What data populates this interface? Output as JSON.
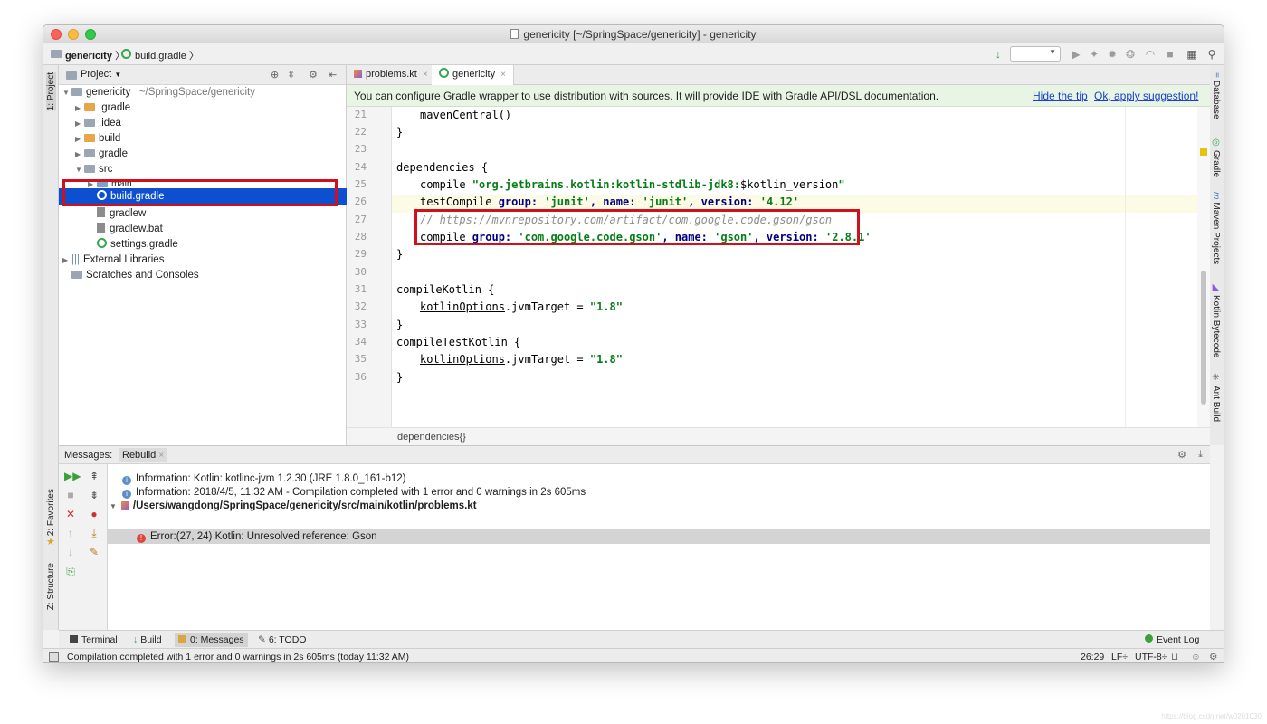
{
  "window": {
    "title": "genericity [~/SpringSpace/genericity] - genericity"
  },
  "breadcrumb": {
    "project": "genericity",
    "file": "build.gradle"
  },
  "toolwindows": {
    "left": {
      "project": "1: Project",
      "favorites": "2: Favorites",
      "structure": "Z: Structure"
    },
    "right": [
      "Database",
      "Gradle",
      "Maven Projects",
      "Kotlin Bytecode",
      "Ant Build"
    ]
  },
  "project_panel": {
    "header": "Project",
    "root": {
      "name": "genericity",
      "path": "~/SpringSpace/genericity"
    },
    "items": [
      {
        "label": ".gradle"
      },
      {
        "label": ".idea"
      },
      {
        "label": "build"
      },
      {
        "label": "gradle"
      },
      {
        "label": "src"
      },
      {
        "label": "main"
      },
      {
        "label": "build.gradle"
      },
      {
        "label": "gradlew"
      },
      {
        "label": "gradlew.bat"
      },
      {
        "label": "settings.gradle"
      },
      {
        "label": "External Libraries"
      },
      {
        "label": "Scratches and Consoles"
      }
    ]
  },
  "editor": {
    "tabs": [
      {
        "label": "problems.kt"
      },
      {
        "label": "genericity"
      }
    ],
    "tip": {
      "message": "You can configure Gradle wrapper to use distribution with sources. It will provide IDE with Gradle API/DSL documentation.",
      "hide": "Hide the tip",
      "apply": "Ok, apply suggestion!"
    },
    "line_numbers": [
      "21",
      "22",
      "23",
      "24",
      "25",
      "26",
      "27",
      "28",
      "29",
      "30",
      "31",
      "32",
      "33",
      "34",
      "35",
      "36"
    ],
    "code": {
      "l21": "mavenCentral()",
      "l22": "}",
      "l24": "dependencies {",
      "l25_kw": "compile ",
      "l25_str": "\"org.jetbrains.kotlin:kotlin-stdlib-jdk8:",
      "l25_var": "$kotlin_version",
      "l25_end": "\"",
      "l26_kw": "testCompile ",
      "l26_g": "group: ",
      "l26_gv": "'junit'",
      "l26_n": ", name: ",
      "l26_nv": "'junit'",
      "l26_v": ", version: ",
      "l26_vv": "'4.12'",
      "l27": "// https://mvnrepository.com/artifact/com.google.code.gson/gson",
      "l28_kw": "compile ",
      "l28_g": "group: ",
      "l28_gv": "'com.google.code.gson'",
      "l28_n": ", name: ",
      "l28_nv": "'gson'",
      "l28_v": ", version: ",
      "l28_vv": "'2.8.1'",
      "l29": "}",
      "l31": "compileKotlin {",
      "l32_a": "kotlinOptions",
      "l32_b": ".jvmTarget = ",
      "l32_c": "\"1.8\"",
      "l33": "}",
      "l34": "compileTestKotlin {",
      "l35_a": "kotlinOptions",
      "l35_b": ".jvmTarget = ",
      "l35_c": "\"1.8\"",
      "l36": "}"
    },
    "footer": "dependencies{}"
  },
  "messages": {
    "label": "Messages:",
    "tab": "Rebuild",
    "lines": [
      "Information: Kotlin: kotlinc-jvm 1.2.30 (JRE 1.8.0_161-b12)",
      "Information: 2018/4/5, 11:32 AM - Compilation completed with 1 error and 0 warnings in 2s 605ms",
      "/Users/wangdong/SpringSpace/genericity/src/main/kotlin/problems.kt",
      "Error:(27, 24)  Kotlin: Unresolved reference: Gson"
    ]
  },
  "bottom_tabs": [
    "Terminal",
    "Build",
    "0: Messages",
    "6: TODO"
  ],
  "event_log": "Event Log",
  "status": {
    "message": "Compilation completed with 1 error and 0 warnings in 2s 605ms (today 11:32 AM)",
    "position": "26:29",
    "line_sep": "LF÷",
    "encoding": "UTF-8÷"
  },
  "watermark": "https://blog.csdn.net/w0201030"
}
